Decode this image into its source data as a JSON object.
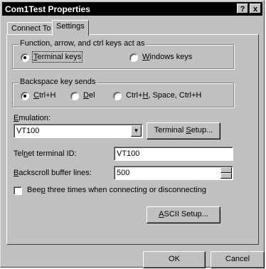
{
  "window": {
    "title": "Com1Test Properties",
    "help_label": "?",
    "close_label": "x"
  },
  "tabs": [
    {
      "label": "Connect To",
      "active": false
    },
    {
      "label": "Settings",
      "active": true
    }
  ],
  "function_group": {
    "legend": "Function, arrow, and ctrl keys act as",
    "options": [
      {
        "prefix": "",
        "hotkey": "T",
        "rest": "erminal keys",
        "selected": true
      },
      {
        "prefix": "",
        "hotkey": "W",
        "rest": "indows keys",
        "selected": false
      }
    ]
  },
  "backspace_group": {
    "legend": "Backspace key sends",
    "options": [
      {
        "prefix": "",
        "hotkey": "C",
        "rest": "trl+H",
        "selected": true
      },
      {
        "prefix": "",
        "hotkey": "D",
        "rest": "el",
        "selected": false
      },
      {
        "prefix": "Ctrl+",
        "hotkey": "H",
        "rest": ", Space, Ctrl+H",
        "selected": false
      }
    ]
  },
  "emulation": {
    "label_hotkey": "E",
    "label_rest": "mulation:",
    "value": "VT100",
    "dropdown_arrow": "▼",
    "setup_prefix": "Terminal ",
    "setup_hotkey": "S",
    "setup_rest": "etup..."
  },
  "telnet": {
    "label_prefix": "Tel",
    "label_hotkey": "n",
    "label_rest": "et terminal ID:",
    "value": "VT100"
  },
  "backscroll": {
    "label_hotkey": "B",
    "label_rest": "ackscroll buffer lines:",
    "value": "500"
  },
  "beep": {
    "label_prefix": "Bee",
    "label_hotkey": "p",
    "label_rest": " three times when connecting or disconnecting",
    "checked": false
  },
  "ascii": {
    "hotkey": "A",
    "rest": "SCII Setup..."
  },
  "footer": {
    "ok_label": "OK",
    "cancel_label": "Cancel"
  }
}
